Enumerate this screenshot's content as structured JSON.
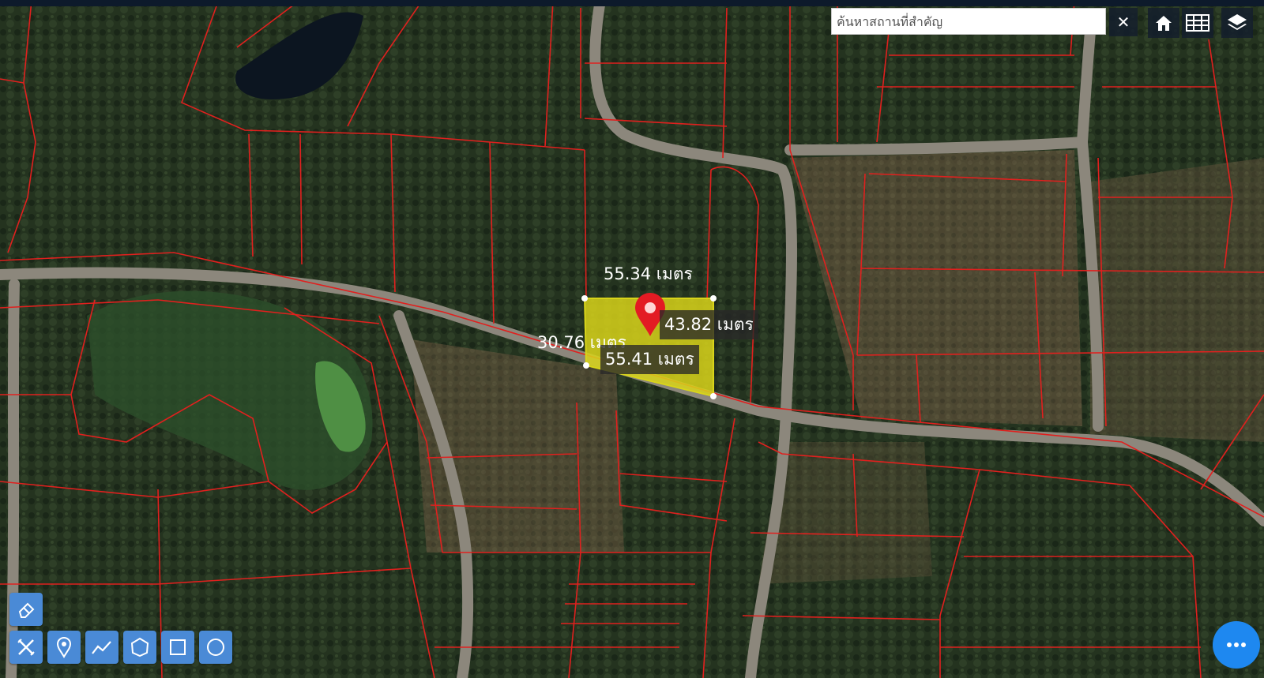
{
  "search": {
    "placeholder": "ค้นหาสถานที่สำคัญ",
    "value": ""
  },
  "toolbar": {
    "icons": [
      "close-icon",
      "home-icon",
      "grid-icon",
      "layers-icon"
    ]
  },
  "measurements": {
    "top": "55.34 เมตร",
    "right": "43.82 เมตร",
    "left": "30.76 เมตร",
    "bottom": "55.41 เมตร"
  },
  "draw_tools": {
    "icons": [
      "eraser-icon",
      "clear-tools-icon",
      "marker-icon",
      "polyline-icon",
      "polygon-icon",
      "rectangle-icon",
      "circle-icon"
    ]
  },
  "more_menu": {
    "icon": "more-icon"
  },
  "colors": {
    "parcel_line": "#e0201e",
    "selected_fill": "#d8d41a",
    "tool_blue": "#4a8ad6",
    "fab_blue": "#1e88f0"
  }
}
